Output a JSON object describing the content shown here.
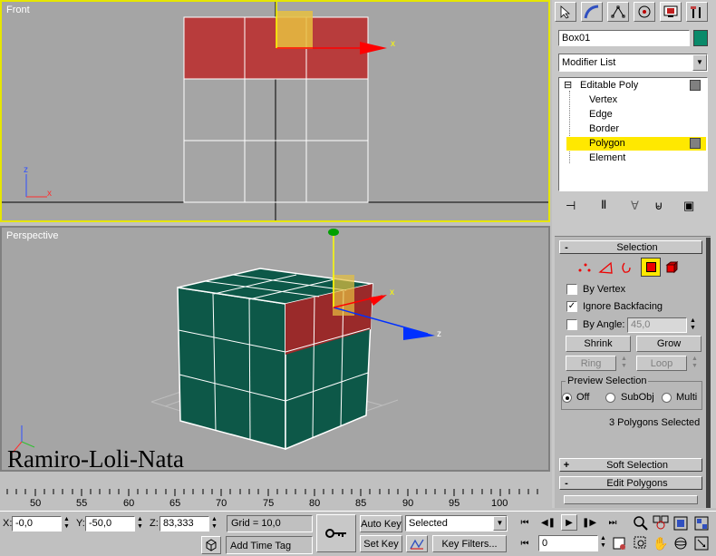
{
  "viewports": {
    "front_label": "Front",
    "perspective_label": "Perspective",
    "watermark": "Ramiro-Loli-Nata",
    "axis_x": "x",
    "axis_y": "y",
    "axis_z": "z"
  },
  "command_panel": {
    "tabs": [
      "create-icon",
      "modify-icon",
      "hierarchy-icon",
      "motion-icon",
      "display-icon",
      "utilities-icon"
    ],
    "object_name": "Box01",
    "object_color": "#0a8a6a",
    "modifier_list": "Modifier List",
    "stack": {
      "root": "Editable Poly",
      "root_toggle": "⊟",
      "items": [
        "Vertex",
        "Edge",
        "Border",
        "Polygon",
        "Element"
      ],
      "selected": "Polygon"
    }
  },
  "selection_rollout": {
    "sign": "-",
    "title": "Selection",
    "by_vertex": "By Vertex",
    "ignore_backfacing": "Ignore Backfacing",
    "ignore_backfacing_checked": true,
    "by_angle": "By Angle:",
    "angle_value": "45,0",
    "shrink": "Shrink",
    "grow": "Grow",
    "ring": "Ring",
    "loop": "Loop",
    "preview_title": "Preview Selection",
    "preview_off": "Off",
    "preview_subobj": "SubObj",
    "preview_multi": "Multi",
    "status": "3 Polygons Selected"
  },
  "soft_selection": {
    "sign": "+",
    "title": "Soft Selection"
  },
  "edit_polygons": {
    "sign": "-",
    "title": "Edit Polygons"
  },
  "timeline": {
    "ticks": [
      "50",
      "55",
      "60",
      "65",
      "70",
      "75",
      "80",
      "85",
      "90",
      "95",
      "100"
    ]
  },
  "status_bar": {
    "x_label": "X:",
    "x_value": "-0,0",
    "y_label": "Y:",
    "y_value": "-50,0",
    "z_label": "Z:",
    "z_value": "83,333",
    "grid": "Grid = 10,0",
    "add_time_tag": "Add Time Tag",
    "auto_key": "Auto Key",
    "set_key": "Set Key",
    "selected": "Selected",
    "key_filters": "Key Filters...",
    "frame": "0"
  }
}
